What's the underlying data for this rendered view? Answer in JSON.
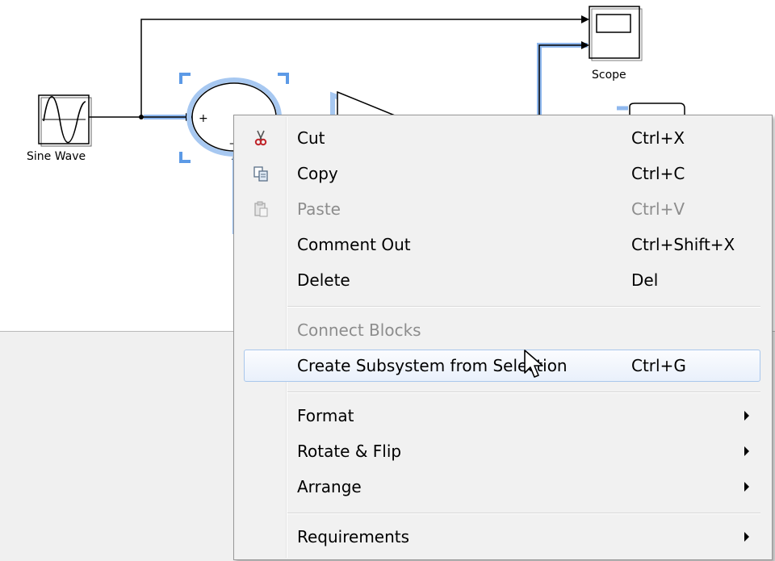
{
  "diagram": {
    "blocks": {
      "sine_wave": "Sine Wave",
      "scope": "Scope",
      "sum_plus": "+",
      "sum_minus": "–"
    }
  },
  "context_menu": {
    "items": [
      {
        "id": "cut",
        "label": "Cut",
        "shortcut": "Ctrl+X",
        "icon": "scissors-icon"
      },
      {
        "id": "copy",
        "label": "Copy",
        "shortcut": "Ctrl+C",
        "icon": "copy-icon"
      },
      {
        "id": "paste",
        "label": "Paste",
        "shortcut": "Ctrl+V",
        "icon": "paste-icon",
        "disabled": true
      },
      {
        "id": "comment-out",
        "label": "Comment Out",
        "shortcut": "Ctrl+Shift+X"
      },
      {
        "id": "delete",
        "label": "Delete",
        "shortcut": "Del"
      },
      {
        "id": "connect-blocks",
        "label": "Connect Blocks",
        "disabled": true
      },
      {
        "id": "create-subsystem",
        "label": "Create Subsystem from Selection",
        "shortcut": "Ctrl+G",
        "highlighted": true
      },
      {
        "id": "format",
        "label": "Format",
        "submenu": true
      },
      {
        "id": "rotate-flip",
        "label": "Rotate & Flip",
        "submenu": true
      },
      {
        "id": "arrange",
        "label": "Arrange",
        "submenu": true
      },
      {
        "id": "requirements",
        "label": "Requirements",
        "submenu": true
      }
    ]
  },
  "colors": {
    "selection_blue": "#5c9ae6",
    "signal_line": "#000000",
    "menu_background": "#f1f1f1",
    "highlight_border": "#a9c7ec",
    "disabled_text": "#8d8d8d"
  }
}
